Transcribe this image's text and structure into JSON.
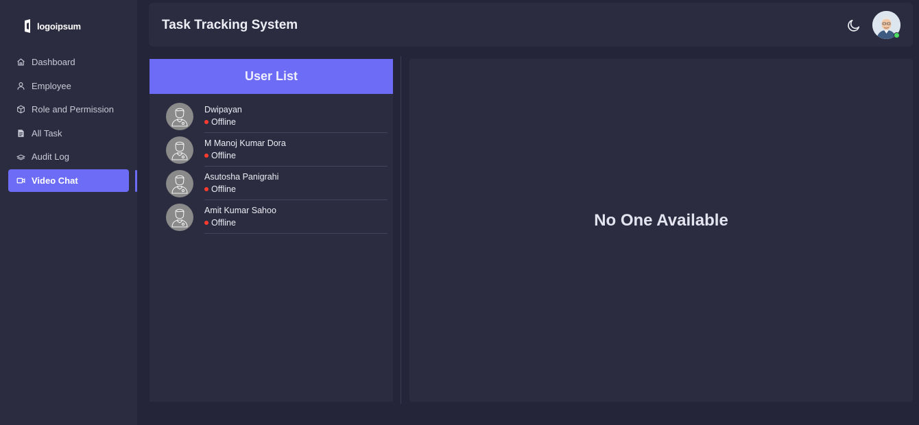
{
  "logo": {
    "text": "logoipsum",
    "icon": "logo-mark-icon"
  },
  "sidebar": {
    "items": [
      {
        "label": "Dashboard",
        "icon": "home-icon"
      },
      {
        "label": "Employee",
        "icon": "user-icon"
      },
      {
        "label": "Role and Permission",
        "icon": "cube-icon"
      },
      {
        "label": "All Task",
        "icon": "document-icon"
      },
      {
        "label": "Audit Log",
        "icon": "layers-icon"
      },
      {
        "label": "Video Chat",
        "icon": "video-icon",
        "active": true
      }
    ]
  },
  "header": {
    "title": "Task Tracking System",
    "theme_icon": "moon-icon",
    "avatar_status": "online"
  },
  "user_list": {
    "title": "User List",
    "users": [
      {
        "name": "Dwipayan",
        "status": "Offline"
      },
      {
        "name": "M Manoj Kumar Dora",
        "status": "Offline"
      },
      {
        "name": "Asutosha Panigrahi",
        "status": "Offline"
      },
      {
        "name": "Amit Kumar Sahoo",
        "status": "Offline"
      }
    ]
  },
  "video": {
    "message": "No One Available"
  },
  "colors": {
    "accent": "#6c6cf7",
    "background": "#25253a",
    "panel": "#2c2c40",
    "offline": "#ff3b30",
    "online": "#4cd964"
  }
}
